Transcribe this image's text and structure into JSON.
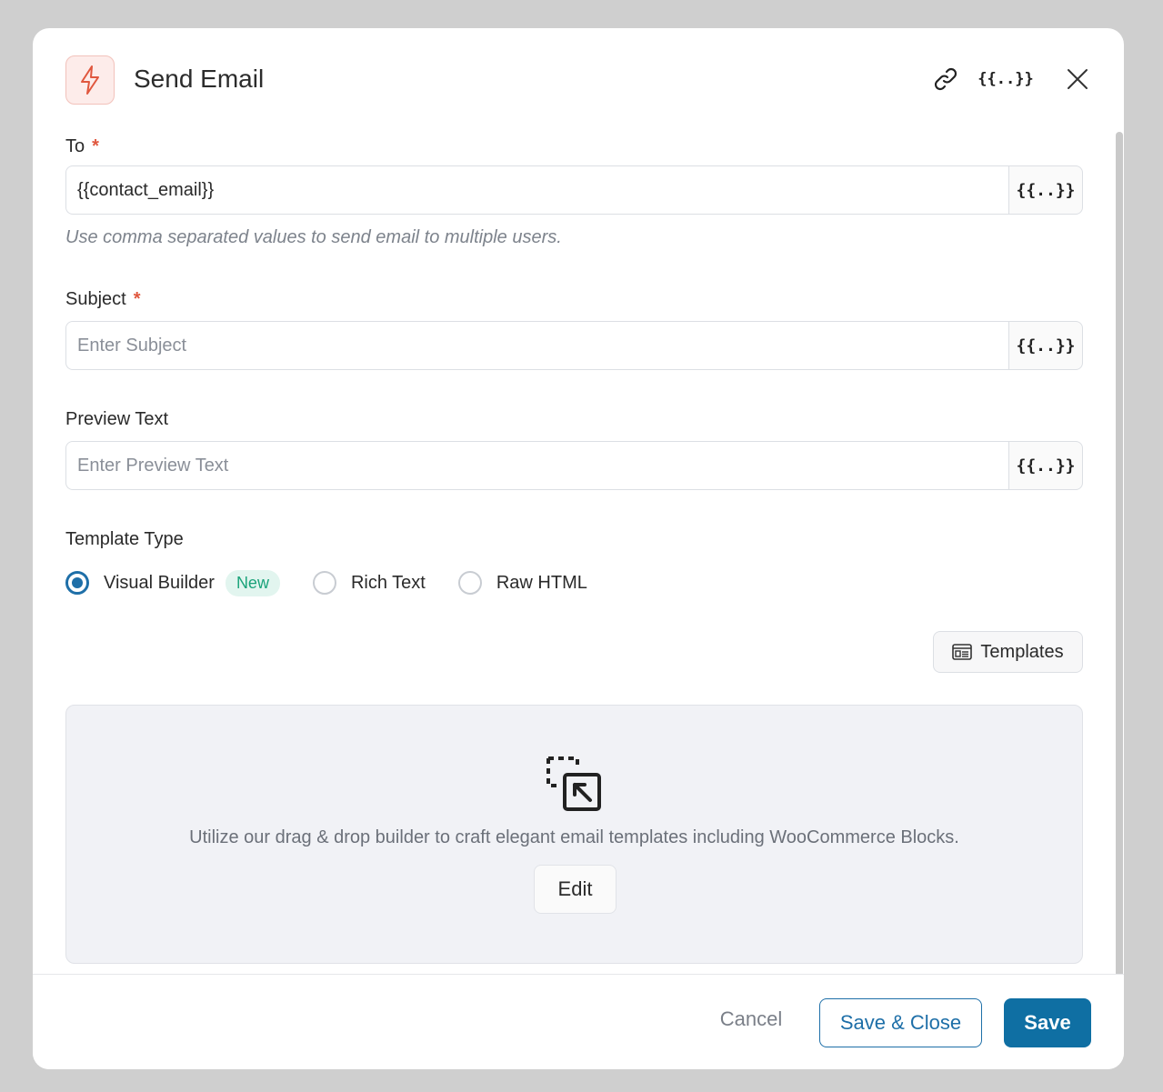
{
  "header": {
    "title": "Send Email",
    "icon": "lightning-icon",
    "actions": [
      {
        "icon": "link-icon"
      },
      {
        "icon": "merge-tags-icon",
        "label": "{{..}}"
      },
      {
        "icon": "close-icon"
      }
    ]
  },
  "fields": {
    "to": {
      "label": "To",
      "required_mark": "*",
      "value": "{{contact_email}}",
      "placeholder": "",
      "help": "Use comma separated values to send email to multiple users.",
      "tag_button": "{{..}}"
    },
    "subject": {
      "label": "Subject",
      "required_mark": "*",
      "value": "",
      "placeholder": "Enter Subject",
      "tag_button": "{{..}}"
    },
    "preview_text": {
      "label": "Preview Text",
      "value": "",
      "placeholder": "Enter Preview Text",
      "tag_button": "{{..}}"
    }
  },
  "template_type": {
    "label": "Template Type",
    "options": [
      {
        "label": "Visual Builder",
        "badge": "New",
        "selected": true
      },
      {
        "label": "Rich Text",
        "selected": false
      },
      {
        "label": "Raw HTML",
        "selected": false
      }
    ],
    "templates_button": "Templates"
  },
  "builder": {
    "icon": "drag-drop-icon",
    "description": "Utilize our drag & drop builder to craft elegant email templates including WooCommerce Blocks.",
    "edit_label": "Edit"
  },
  "footer": {
    "cancel_label": "Cancel",
    "save_close_label": "Save & Close",
    "save_label": "Save"
  },
  "colors": {
    "primary": "#1e6fa8",
    "required": "#e0573e",
    "badge_text": "#1aa37a",
    "badge_bg": "#e2f5ef",
    "builder_bg": "#f1f2f6"
  }
}
